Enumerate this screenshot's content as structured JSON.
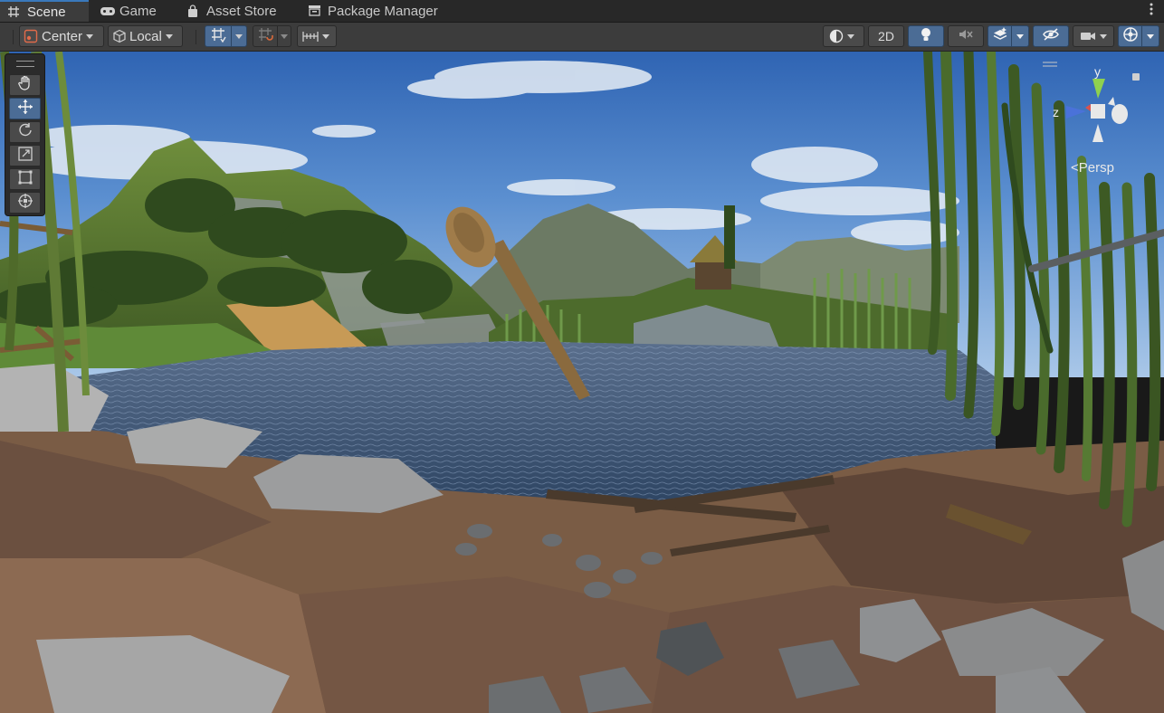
{
  "tabs": [
    {
      "label": "Scene",
      "icon": "grid-icon",
      "active": true
    },
    {
      "label": "Game",
      "icon": "gamepad-icon",
      "active": false
    },
    {
      "label": "Asset Store",
      "icon": "shopping-bag-icon",
      "active": false
    },
    {
      "label": "Package Manager",
      "icon": "package-icon",
      "active": false
    }
  ],
  "toolbar": {
    "pivot_mode": "Center",
    "pivot_rotation": "Local",
    "mode_2d": "2D"
  },
  "gizmo": {
    "axis_y": "y",
    "axis_z": "z",
    "projection": "<Persp"
  },
  "colors": {
    "accent": "#4b6c95",
    "sky_top": "#3d74c0",
    "water": "#3f5675",
    "ground": "#7a5c45"
  }
}
